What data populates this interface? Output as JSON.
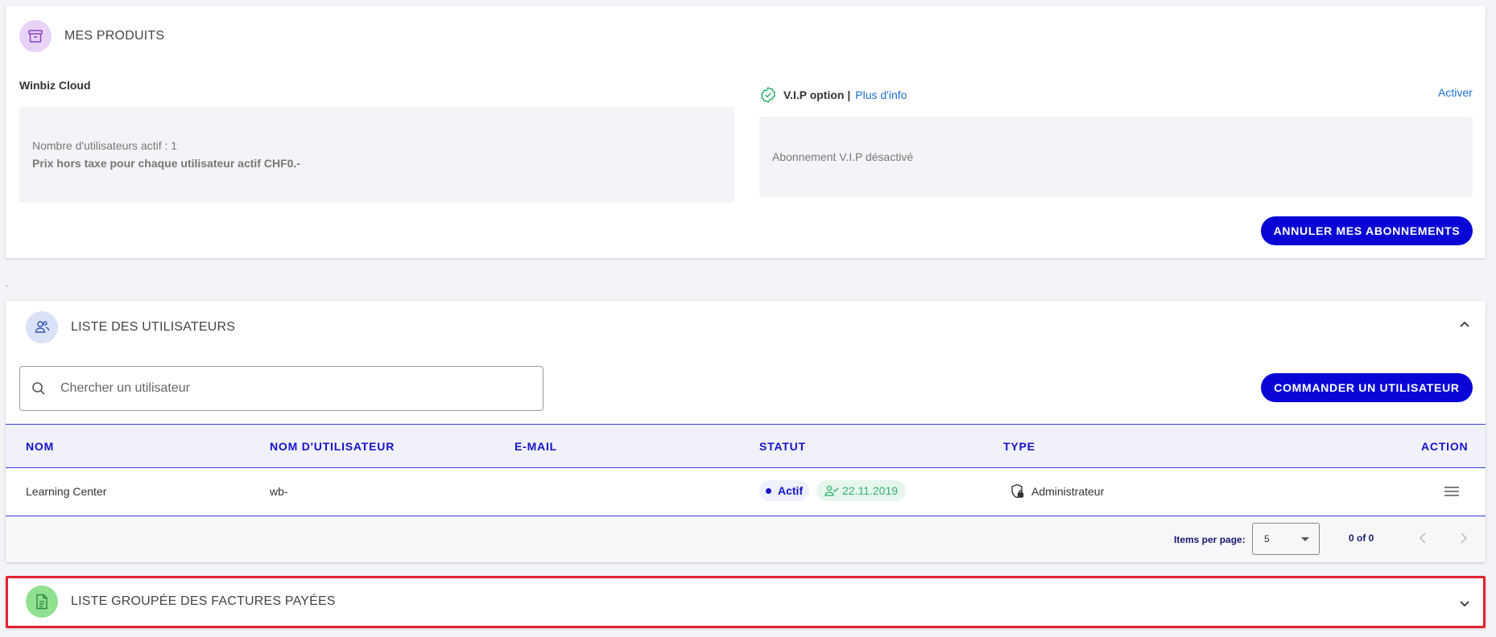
{
  "products": {
    "title": "MES PRODUITS",
    "cloud": {
      "title": "Winbiz Cloud",
      "users_active": "Nombre d'utilisateurs actif : 1",
      "price": "Prix hors taxe pour chaque utilisateur actif CHF0.-"
    },
    "vip": {
      "label": "V.I.P option |",
      "more_info": "Plus d'info",
      "activate": "Activer",
      "status": "Abonnement V.I.P désactivé"
    },
    "cancel_button": "ANNULER MES ABONNEMENTS"
  },
  "separator": ".",
  "users": {
    "title": "LISTE DES UTILISATEURS",
    "search_placeholder": "Chercher un utilisateur",
    "order_button": "COMMANDER UN UTILISATEUR",
    "columns": [
      "NOM",
      "NOM D'UTILISATEUR",
      "E-MAIL",
      "STATUT",
      "TYPE",
      "ACTION"
    ],
    "rows": [
      {
        "name": "Learning Center",
        "username": "wb-",
        "email": "",
        "status": "Actif",
        "date": "22.11.2019",
        "type": "Administrateur"
      }
    ],
    "pagination": {
      "items_per_page_label": "Items per page:",
      "items_per_page": "5",
      "range": "0 of 0"
    }
  },
  "invoices": {
    "title": "LISTE GROUPÉE DES FACTURES PAYÉES"
  },
  "colors": {
    "primary": "#0a05d6",
    "link": "#1f6ed4",
    "highlight_border": "#e3232f",
    "success": "#2fb36b"
  }
}
